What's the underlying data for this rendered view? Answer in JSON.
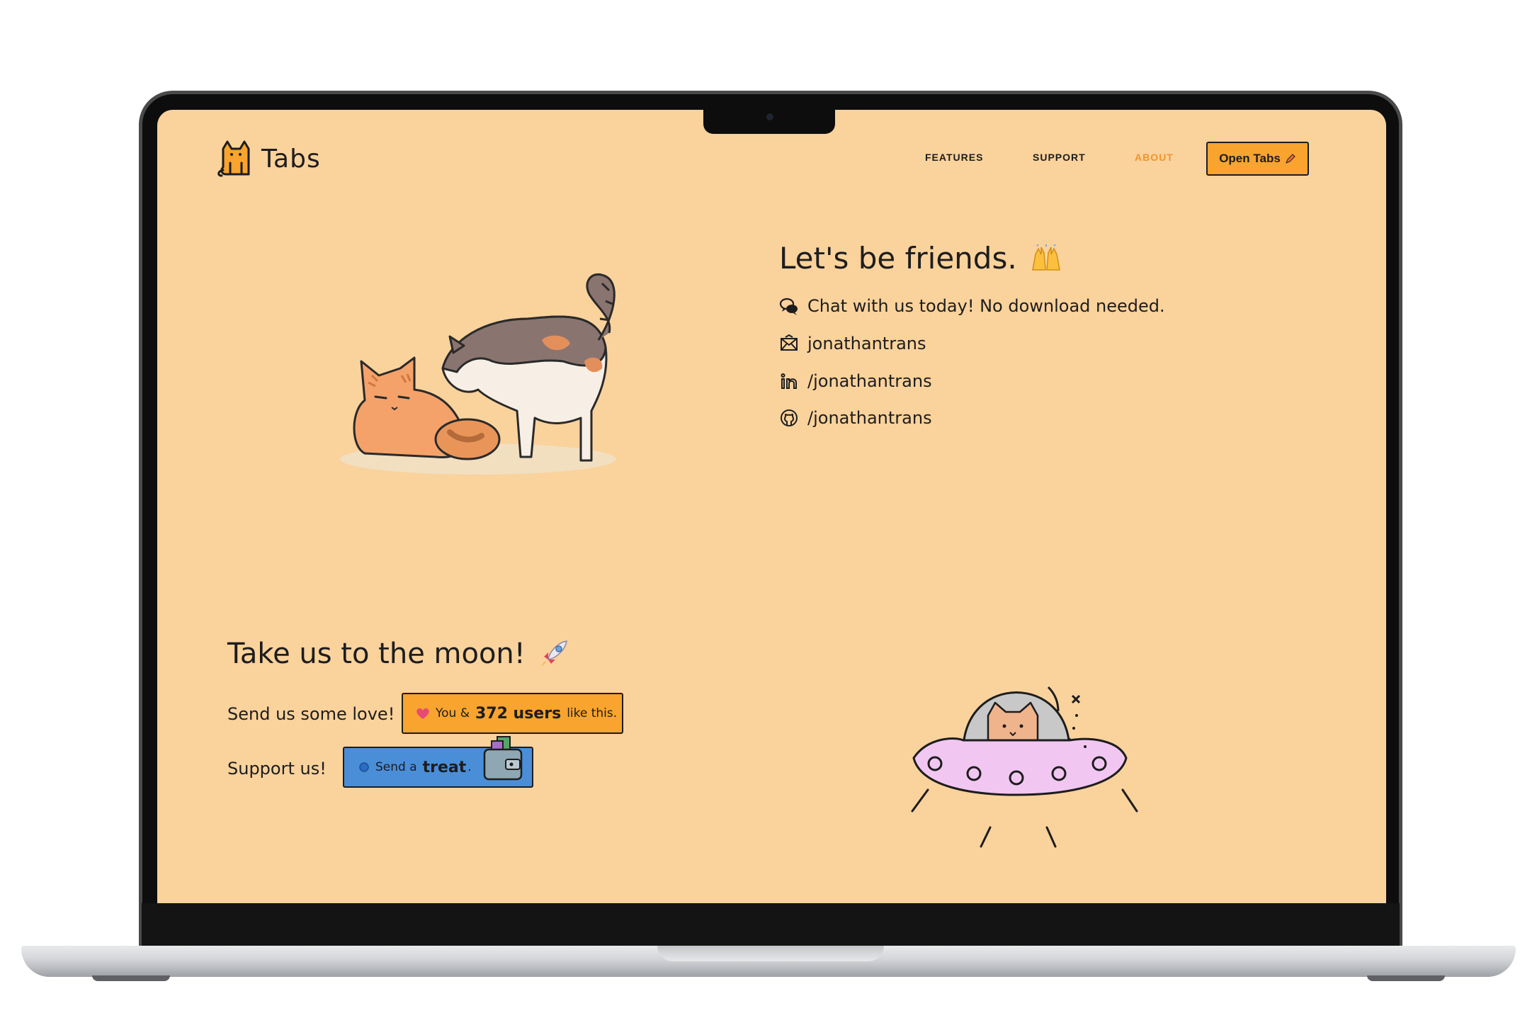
{
  "brand": {
    "name": "Tabs"
  },
  "nav": {
    "items": [
      {
        "label": "FEATURES",
        "active": false
      },
      {
        "label": "SUPPORT",
        "active": false
      },
      {
        "label": "ABOUT",
        "active": true
      }
    ],
    "cta_label": "Open Tabs"
  },
  "friends": {
    "heading": "Let's be friends.",
    "chat_text": "Chat with us today! No download needed.",
    "email_text": "jonathantrans",
    "linkedin_text": "/jonathantrans",
    "github_text": "/jonathantrans"
  },
  "moon": {
    "heading": "Take us to the moon!",
    "love_label": "Send us some love!",
    "like_prefix": "You &",
    "like_count": "372 users",
    "like_suffix": "like this.",
    "support_label": "Support us!",
    "treat_prefix": "Send a",
    "treat_word": "treat",
    "treat_suffix": "."
  },
  "colors": {
    "background": "#fad29c",
    "accent": "#f8a42e",
    "active_nav": "#f0962b",
    "treat_button": "#4a8ed8"
  },
  "icons": {
    "logo": "cat-logo-icon",
    "friends_heading": "raised-hands-icon",
    "chat": "speech-bubbles-icon",
    "email": "envelope-icon",
    "linkedin": "linkedin-icon",
    "github": "github-icon",
    "moon_heading": "rocket-icon",
    "like": "heart-icon",
    "treat": "coin-icon",
    "wallet": "wallet-icon",
    "cta": "pencil-icon"
  }
}
